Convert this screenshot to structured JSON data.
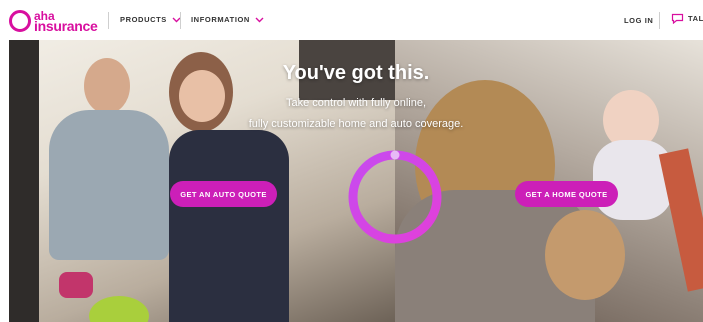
{
  "header": {
    "logo": {
      "line1": "aha",
      "line2": "insurance"
    },
    "nav": [
      {
        "label": "PRODUCTS"
      },
      {
        "label": "INFORMATION"
      }
    ],
    "login_label": "LOG IN",
    "talk_label": "TALK"
  },
  "hero": {
    "headline": "You've got this.",
    "subline1": "Take control with fully online,",
    "subline2": "fully customizable home and auto coverage.",
    "cta_auto": "GET AN AUTO QUOTE",
    "cta_home": "GET A HOME QUOTE"
  },
  "colors": {
    "brand": "#d80f9f",
    "button": "#cc1fb8",
    "ring_gradient": [
      "#c64bf0",
      "#e23fd9"
    ]
  },
  "icons": [
    "logo-ring-icon",
    "chevron-down-icon",
    "chat-bubble-icon",
    "loading-ring-icon"
  ]
}
